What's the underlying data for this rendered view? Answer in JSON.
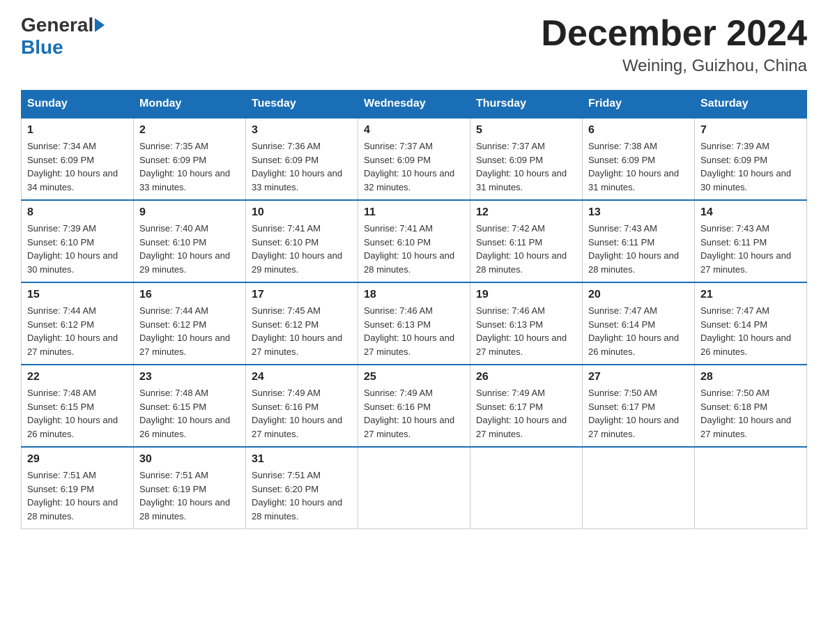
{
  "header": {
    "logo_general": "General",
    "logo_blue": "Blue",
    "month_title": "December 2024",
    "location": "Weining, Guizhou, China"
  },
  "days_of_week": [
    "Sunday",
    "Monday",
    "Tuesday",
    "Wednesday",
    "Thursday",
    "Friday",
    "Saturday"
  ],
  "weeks": [
    [
      {
        "day": "1",
        "sunrise": "7:34 AM",
        "sunset": "6:09 PM",
        "daylight": "10 hours and 34 minutes."
      },
      {
        "day": "2",
        "sunrise": "7:35 AM",
        "sunset": "6:09 PM",
        "daylight": "10 hours and 33 minutes."
      },
      {
        "day": "3",
        "sunrise": "7:36 AM",
        "sunset": "6:09 PM",
        "daylight": "10 hours and 33 minutes."
      },
      {
        "day": "4",
        "sunrise": "7:37 AM",
        "sunset": "6:09 PM",
        "daylight": "10 hours and 32 minutes."
      },
      {
        "day": "5",
        "sunrise": "7:37 AM",
        "sunset": "6:09 PM",
        "daylight": "10 hours and 31 minutes."
      },
      {
        "day": "6",
        "sunrise": "7:38 AM",
        "sunset": "6:09 PM",
        "daylight": "10 hours and 31 minutes."
      },
      {
        "day": "7",
        "sunrise": "7:39 AM",
        "sunset": "6:09 PM",
        "daylight": "10 hours and 30 minutes."
      }
    ],
    [
      {
        "day": "8",
        "sunrise": "7:39 AM",
        "sunset": "6:10 PM",
        "daylight": "10 hours and 30 minutes."
      },
      {
        "day": "9",
        "sunrise": "7:40 AM",
        "sunset": "6:10 PM",
        "daylight": "10 hours and 29 minutes."
      },
      {
        "day": "10",
        "sunrise": "7:41 AM",
        "sunset": "6:10 PM",
        "daylight": "10 hours and 29 minutes."
      },
      {
        "day": "11",
        "sunrise": "7:41 AM",
        "sunset": "6:10 PM",
        "daylight": "10 hours and 28 minutes."
      },
      {
        "day": "12",
        "sunrise": "7:42 AM",
        "sunset": "6:11 PM",
        "daylight": "10 hours and 28 minutes."
      },
      {
        "day": "13",
        "sunrise": "7:43 AM",
        "sunset": "6:11 PM",
        "daylight": "10 hours and 28 minutes."
      },
      {
        "day": "14",
        "sunrise": "7:43 AM",
        "sunset": "6:11 PM",
        "daylight": "10 hours and 27 minutes."
      }
    ],
    [
      {
        "day": "15",
        "sunrise": "7:44 AM",
        "sunset": "6:12 PM",
        "daylight": "10 hours and 27 minutes."
      },
      {
        "day": "16",
        "sunrise": "7:44 AM",
        "sunset": "6:12 PM",
        "daylight": "10 hours and 27 minutes."
      },
      {
        "day": "17",
        "sunrise": "7:45 AM",
        "sunset": "6:12 PM",
        "daylight": "10 hours and 27 minutes."
      },
      {
        "day": "18",
        "sunrise": "7:46 AM",
        "sunset": "6:13 PM",
        "daylight": "10 hours and 27 minutes."
      },
      {
        "day": "19",
        "sunrise": "7:46 AM",
        "sunset": "6:13 PM",
        "daylight": "10 hours and 27 minutes."
      },
      {
        "day": "20",
        "sunrise": "7:47 AM",
        "sunset": "6:14 PM",
        "daylight": "10 hours and 26 minutes."
      },
      {
        "day": "21",
        "sunrise": "7:47 AM",
        "sunset": "6:14 PM",
        "daylight": "10 hours and 26 minutes."
      }
    ],
    [
      {
        "day": "22",
        "sunrise": "7:48 AM",
        "sunset": "6:15 PM",
        "daylight": "10 hours and 26 minutes."
      },
      {
        "day": "23",
        "sunrise": "7:48 AM",
        "sunset": "6:15 PM",
        "daylight": "10 hours and 26 minutes."
      },
      {
        "day": "24",
        "sunrise": "7:49 AM",
        "sunset": "6:16 PM",
        "daylight": "10 hours and 27 minutes."
      },
      {
        "day": "25",
        "sunrise": "7:49 AM",
        "sunset": "6:16 PM",
        "daylight": "10 hours and 27 minutes."
      },
      {
        "day": "26",
        "sunrise": "7:49 AM",
        "sunset": "6:17 PM",
        "daylight": "10 hours and 27 minutes."
      },
      {
        "day": "27",
        "sunrise": "7:50 AM",
        "sunset": "6:17 PM",
        "daylight": "10 hours and 27 minutes."
      },
      {
        "day": "28",
        "sunrise": "7:50 AM",
        "sunset": "6:18 PM",
        "daylight": "10 hours and 27 minutes."
      }
    ],
    [
      {
        "day": "29",
        "sunrise": "7:51 AM",
        "sunset": "6:19 PM",
        "daylight": "10 hours and 28 minutes."
      },
      {
        "day": "30",
        "sunrise": "7:51 AM",
        "sunset": "6:19 PM",
        "daylight": "10 hours and 28 minutes."
      },
      {
        "day": "31",
        "sunrise": "7:51 AM",
        "sunset": "6:20 PM",
        "daylight": "10 hours and 28 minutes."
      },
      null,
      null,
      null,
      null
    ]
  ]
}
